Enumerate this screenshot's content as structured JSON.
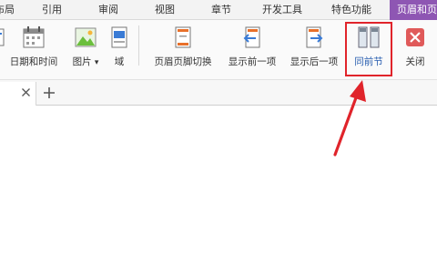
{
  "menu": {
    "items": [
      "布局",
      "引用",
      "审阅",
      "视图",
      "章节",
      "开发工具",
      "特色功能",
      "页眉和页"
    ],
    "active_index": 7
  },
  "ribbon": {
    "date_time": "日期和时间",
    "picture": "图片",
    "picture_arrow": "▾",
    "field": "域",
    "switch_header_footer": "页眉页脚切换",
    "show_previous": "显示前一项",
    "show_next": "显示后一项",
    "same_as_previous": "同前节",
    "close": "关闭"
  },
  "tabs": {
    "close_glyph": "×",
    "add_glyph": "+"
  },
  "colors": {
    "accent_tab": "#8e56b3",
    "highlight": "#e0242b",
    "close_button": "#e05a5a",
    "icon_orange": "#e8702a",
    "icon_blue": "#3a7bd5"
  }
}
